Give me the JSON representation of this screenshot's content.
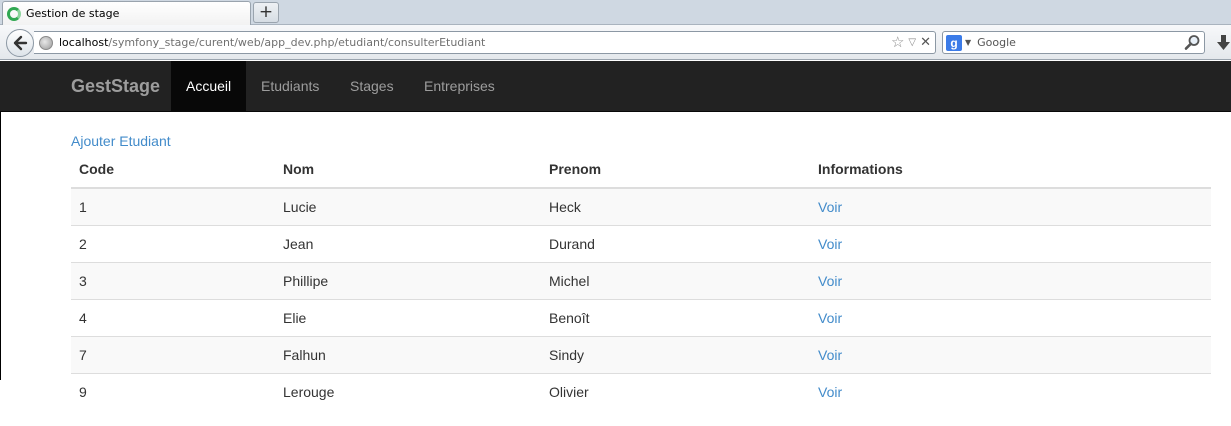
{
  "browser": {
    "tab_title": "Gestion de stage",
    "new_tab_label": "+",
    "url_host": "localhost",
    "url_path": "/symfony_stage/curent/web/app_dev.php/etudiant/consulterEtudiant",
    "search_placeholder": "Google",
    "search_engine_letter": "g"
  },
  "app": {
    "brand": "GestStage",
    "nav": [
      {
        "label": "Accueil",
        "active": true
      },
      {
        "label": "Etudiants",
        "active": false
      },
      {
        "label": "Stages",
        "active": false
      },
      {
        "label": "Entreprises",
        "active": false
      }
    ],
    "add_link": "Ajouter Etudiant",
    "table": {
      "headers": [
        "Code",
        "Nom",
        "Prenom",
        "Informations"
      ],
      "rows": [
        {
          "code": "1",
          "nom": "Lucie",
          "prenom": "Heck",
          "info": "Voir"
        },
        {
          "code": "2",
          "nom": "Jean",
          "prenom": "Durand",
          "info": "Voir"
        },
        {
          "code": "3",
          "nom": "Phillipe",
          "prenom": "Michel",
          "info": "Voir"
        },
        {
          "code": "4",
          "nom": "Elie",
          "prenom": "Benoît",
          "info": "Voir"
        },
        {
          "code": "7",
          "nom": "Falhun",
          "prenom": "Sindy",
          "info": "Voir"
        },
        {
          "code": "9",
          "nom": "Lerouge",
          "prenom": "Olivier",
          "info": "Voir"
        }
      ]
    }
  },
  "colors": {
    "navbar_bg": "#222222",
    "navbar_active_bg": "#080808",
    "link": "#428bca",
    "stripe": "#f9f9f9"
  }
}
